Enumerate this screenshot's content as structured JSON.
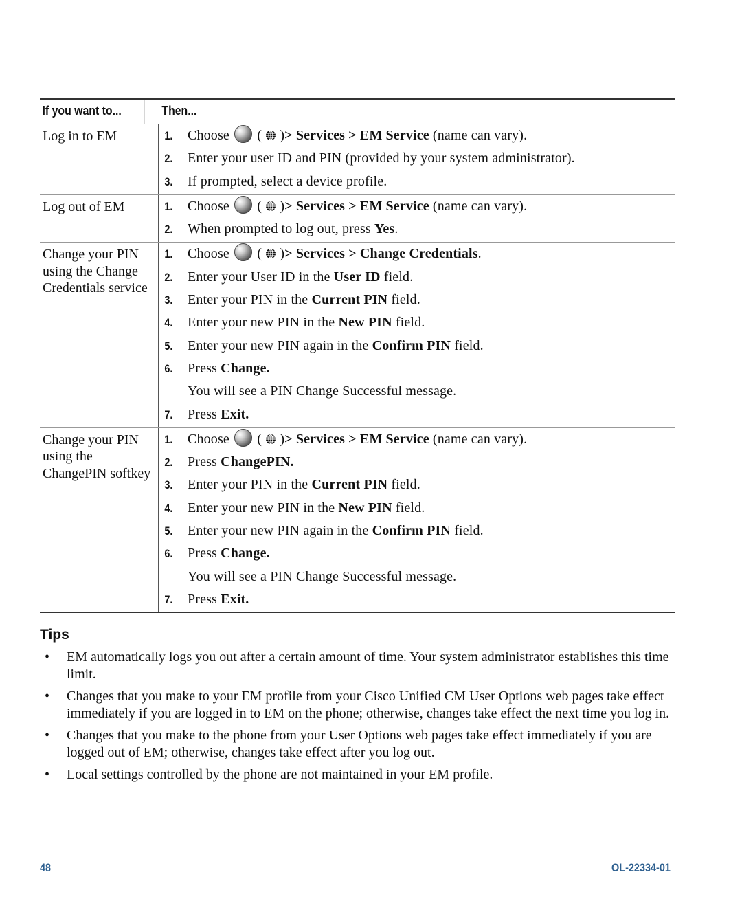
{
  "table": {
    "headers": [
      "If you want to...",
      "Then..."
    ],
    "rows": [
      {
        "task": "Log in to EM",
        "steps": [
          {
            "n": "1.",
            "pre": "Choose",
            "icons": true,
            "bold": "> Services > EM Service",
            "post": " (name can vary)."
          },
          {
            "n": "2.",
            "text": "Enter your user ID and PIN (provided by your system administrator)."
          },
          {
            "n": "3.",
            "text": "If prompted, select a device profile."
          }
        ]
      },
      {
        "task": "Log out of EM",
        "steps": [
          {
            "n": "1.",
            "pre": "Choose",
            "icons": true,
            "bold": "> Services > EM Service",
            "post": " (name can vary)."
          },
          {
            "n": "2.",
            "pre": "When prompted to log out, press ",
            "bold": "Yes",
            "post": "."
          }
        ]
      },
      {
        "task": "Change your PIN using the Change Credentials service",
        "steps": [
          {
            "n": "1.",
            "pre": "Choose",
            "icons": true,
            "bold": "> Services > Change Credentials",
            "post": "."
          },
          {
            "n": "2.",
            "pre": "Enter your User ID in the ",
            "bold": "User ID",
            "post": " field."
          },
          {
            "n": "3.",
            "pre": "Enter your PIN in the ",
            "bold": "Current PIN",
            "post": " field."
          },
          {
            "n": "4.",
            "pre": "Enter your new PIN in the ",
            "bold": "New PIN",
            "post": " field."
          },
          {
            "n": "5.",
            "pre": "Enter your new PIN again in the ",
            "bold": "Confirm PIN",
            "post": " field."
          },
          {
            "n": "6.",
            "pre": "Press ",
            "bold": "Change.",
            "post": ""
          },
          {
            "n": "",
            "text": "You will see a PIN Change Successful message."
          },
          {
            "n": "7.",
            "pre": "Press ",
            "bold": "Exit.",
            "post": ""
          }
        ]
      },
      {
        "task": "Change your PIN using the ChangePIN softkey",
        "steps": [
          {
            "n": "1.",
            "pre": "Choose",
            "icons": true,
            "bold": "> Services > EM Service",
            "post": " (name can vary)."
          },
          {
            "n": "2.",
            "pre": "Press ",
            "bold": "ChangePIN.",
            "post": ""
          },
          {
            "n": "3.",
            "pre": "Enter your PIN in the ",
            "bold": "Current PIN",
            "post": " field."
          },
          {
            "n": "4.",
            "pre": "Enter your new PIN in the ",
            "bold": "New PIN",
            "post": " field."
          },
          {
            "n": "5.",
            "pre": "Enter your new PIN again in the ",
            "bold": "Confirm PIN",
            "post": " field."
          },
          {
            "n": "6.",
            "pre": "Press ",
            "bold": "Change.",
            "post": ""
          },
          {
            "n": "",
            "text": "You will see a PIN Change Successful message."
          },
          {
            "n": "7.",
            "pre": "Press ",
            "bold": "Exit.",
            "post": ""
          }
        ]
      }
    ]
  },
  "tips": {
    "heading": "Tips",
    "bullet": "•",
    "items": [
      "EM automatically logs you out after a certain amount of time. Your system administrator establishes this time limit.",
      "Changes that you make to your EM profile from your Cisco Unified CM User Options web pages take effect immediately if you are logged in to EM on the phone; otherwise, changes take effect the next time you log in.",
      "Changes that you make to the phone from your User Options web pages take effect immediately if you are logged out of EM; otherwise, changes take effect after you log out.",
      "Local settings controlled by the phone are not maintained in your EM profile."
    ]
  },
  "footer": {
    "page_number": "48",
    "doc_id": "OL-22334-01",
    "color": "#2d5f8f"
  },
  "icons": {
    "applications_button": "applications-button-icon",
    "globe": "globe-icon"
  }
}
